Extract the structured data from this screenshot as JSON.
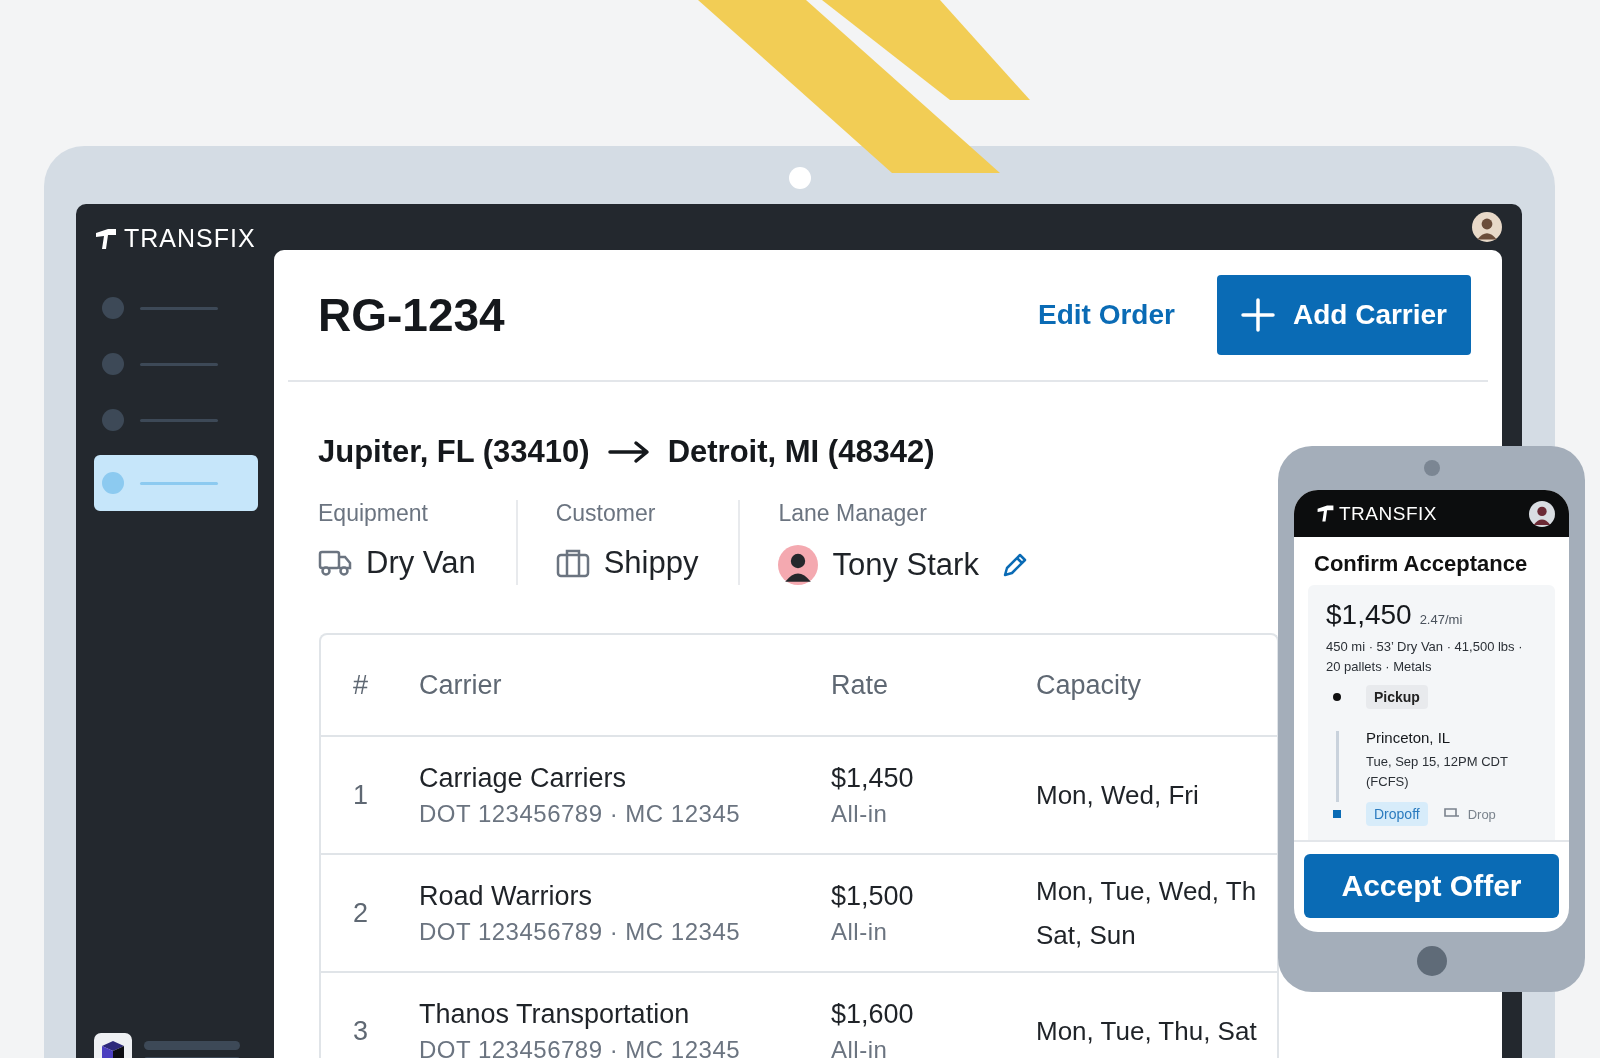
{
  "app": {
    "logo": "TRANSFIX"
  },
  "sidebar": {
    "items": [
      {
        "selected": false
      },
      {
        "selected": false
      },
      {
        "selected": false
      },
      {
        "selected": true
      }
    ]
  },
  "order": {
    "title": "RG-1234",
    "edit_link": "Edit Order",
    "add_button": "Add Carrier"
  },
  "route": {
    "origin": "Jupiter, FL (33410)",
    "destination": "Detroit, MI (48342)"
  },
  "details": [
    {
      "kind": "equipment",
      "label": "Equipment",
      "value": "Dry Van"
    },
    {
      "kind": "customer",
      "label": "Customer",
      "value": "Shippy"
    },
    {
      "kind": "manager",
      "label": "Lane Manager",
      "value": "Tony Stark"
    }
  ],
  "table": {
    "columns": [
      "#",
      "Carrier",
      "Rate",
      "Capacity"
    ],
    "rows": [
      {
        "number": "1",
        "carrier": "Carriage Carriers",
        "ids": "DOT 123456789 · MC 12345",
        "rate": "$1,450",
        "rate_note": "All-in",
        "capacity": [
          "Mon, Wed, Fri"
        ]
      },
      {
        "number": "2",
        "carrier": "Road Warriors",
        "ids": "DOT 123456789 · MC 12345",
        "rate": "$1,500",
        "rate_note": "All-in",
        "capacity": [
          "Mon, Tue, Wed, Th",
          "Sat, Sun"
        ]
      },
      {
        "number": "3",
        "carrier": "Thanos Transportation",
        "ids": "DOT 123456789 · MC 12345",
        "rate": "$1,600",
        "rate_note": "All-in",
        "capacity": [
          "Mon, Tue, Thu, Sat"
        ]
      }
    ]
  },
  "phone": {
    "logo": "TRANSFIX",
    "title": "Confirm Acceptance",
    "price": "$1,450",
    "per_mile": "2.47/mi",
    "summary": "450 mi · 53’ Dry Van · 41,500 lbs · 20 pallets · Metals",
    "stops": [
      {
        "kind": "pickup",
        "tag": "Pickup",
        "city": "Princeton, IL",
        "time": "Tue, Sep 15, 12PM CDT (FCFS)"
      },
      {
        "kind": "dropoff",
        "tag": "Dropoff",
        "extra": "Drop"
      }
    ],
    "button": "Accept Offer"
  }
}
